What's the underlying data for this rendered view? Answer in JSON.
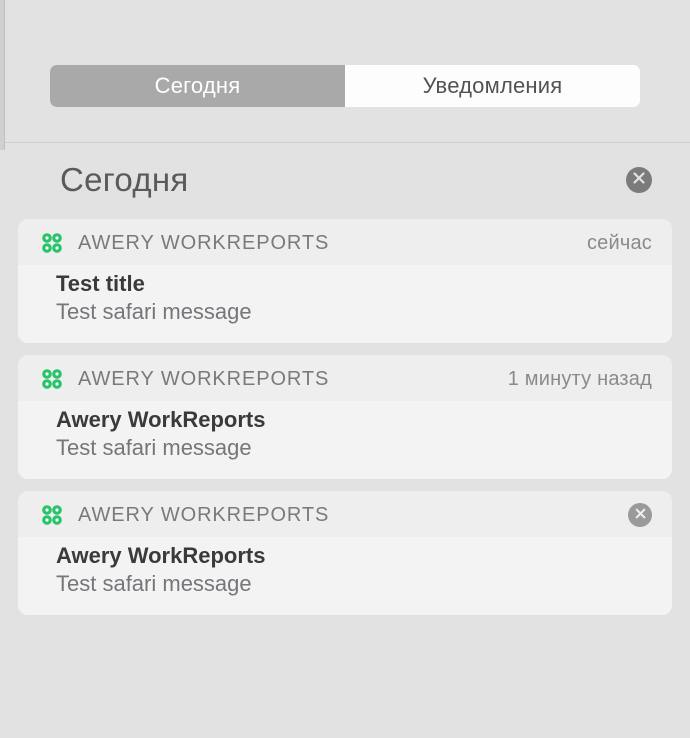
{
  "tabs": {
    "today": "Сегодня",
    "notifications": "Уведомления"
  },
  "section": {
    "title": "Сегодня"
  },
  "notifications": [
    {
      "app_name": "AWERY WORKREPORTS",
      "timestamp": "сейчас",
      "title": "Test title",
      "message": "Test safari message",
      "has_close": false
    },
    {
      "app_name": "AWERY WORKREPORTS",
      "timestamp": "1 минуту назад",
      "title": "Awery WorkReports",
      "message": "Test safari message",
      "has_close": false
    },
    {
      "app_name": "AWERY WORKREPORTS",
      "timestamp": "",
      "title": "Awery WorkReports",
      "message": "Test safari message",
      "has_close": true
    }
  ],
  "colors": {
    "app_icon": "#27c36a"
  }
}
